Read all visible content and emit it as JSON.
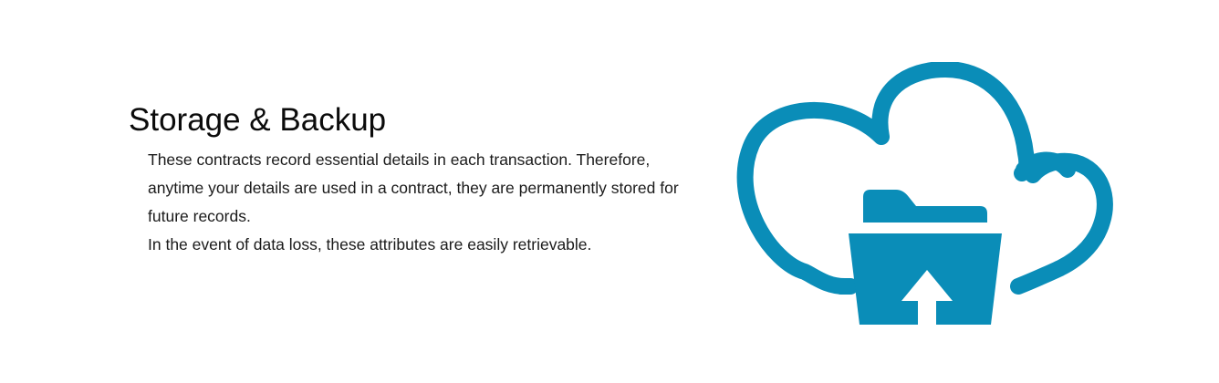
{
  "section": {
    "title": "Storage & Backup",
    "paragraph": "These contracts record essential details in each transaction. Therefore, anytime your details are used in a contract, they are permanently stored for future records.",
    "paragraph2": "In the event of data loss, these attributes are easily retrievable."
  },
  "illustration": {
    "icon": "cloud-folder-upload-icon",
    "color": "#0a8db8"
  }
}
